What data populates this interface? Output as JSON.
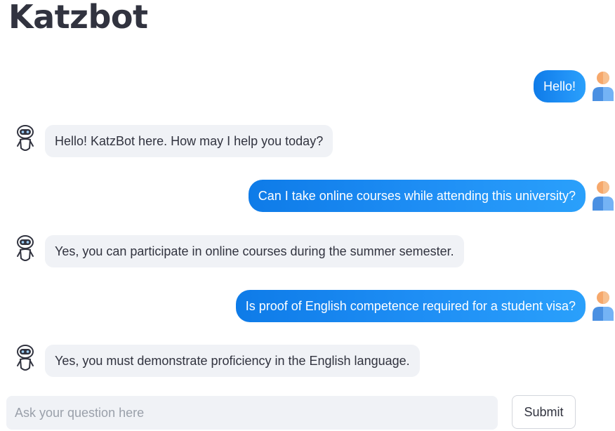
{
  "app": {
    "title": "Katzbot"
  },
  "messages": [
    {
      "role": "user",
      "text": "Hello!"
    },
    {
      "role": "bot",
      "text": "Hello! KatzBot here. How may I help you today?"
    },
    {
      "role": "user",
      "text": "Can I take online courses while attending this university?"
    },
    {
      "role": "bot",
      "text": "Yes, you can participate in online courses during the summer semester."
    },
    {
      "role": "user",
      "text": "Is proof of English competence required for a student visa?"
    },
    {
      "role": "bot",
      "text": "Yes, you must demonstrate proficiency in the English language."
    }
  ],
  "input": {
    "placeholder": "Ask your question here",
    "value": ""
  },
  "submit": {
    "label": "Submit"
  },
  "colors": {
    "user_bubble": "#1f8ff5",
    "bot_bubble": "#f0f2f6",
    "text": "#31333f"
  },
  "icons": {
    "user_avatar": "user-avatar-icon",
    "bot_avatar": "robot-avatar-icon"
  }
}
